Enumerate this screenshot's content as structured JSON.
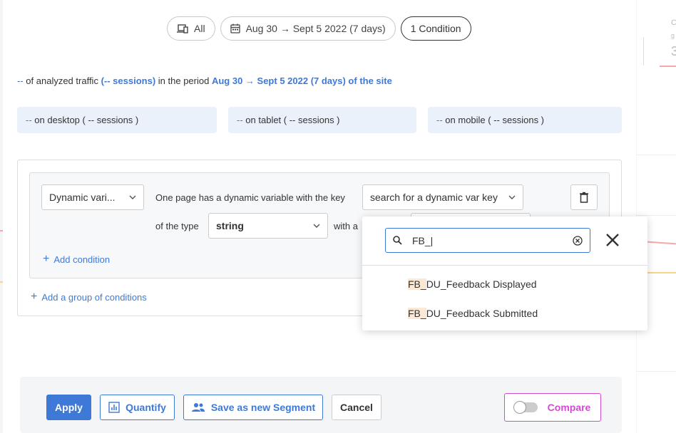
{
  "background": {
    "partial_label": "C",
    "partial_sub": "g",
    "partial_value": "3"
  },
  "chips": {
    "devices": "All",
    "period": "Aug 30 → Sept 5 2022 (7 days)",
    "conditions": "1 Condition"
  },
  "summary": {
    "count": "--",
    "text1": "of analyzed traffic",
    "sessions": "(-- sessions)",
    "text2": "in the period",
    "period": "Aug 30 → Sept 5 2022 (7 days) of the site"
  },
  "devices": [
    {
      "count": "--",
      "label": "on desktop ( -- sessions )"
    },
    {
      "count": "--",
      "label": "on tablet ( -- sessions )"
    },
    {
      "count": "--",
      "label": "on mobile ( -- sessions )"
    }
  ],
  "condition": {
    "type_select": "Dynamic vari...",
    "sentence1": "One page has a dynamic variable with the key",
    "key_select": "search for a dynamic var key",
    "sentence2": "of the type",
    "value_type": "string",
    "sentence3": "with a",
    "add_condition": "Add condition",
    "add_group": "Add a group of conditions"
  },
  "popup": {
    "search_value": "FB_|",
    "options": [
      {
        "highlight": "FB_",
        "rest": "DU_Feedback Displayed"
      },
      {
        "highlight": "FB_",
        "rest": "DU_Feedback Submitted"
      }
    ]
  },
  "actions": {
    "apply": "Apply",
    "quantify": "Quantify",
    "save_segment": "Save as new Segment",
    "cancel": "Cancel",
    "compare": "Compare"
  },
  "colors": {
    "accent": "#3f79d7",
    "compare": "#d24bd2"
  }
}
